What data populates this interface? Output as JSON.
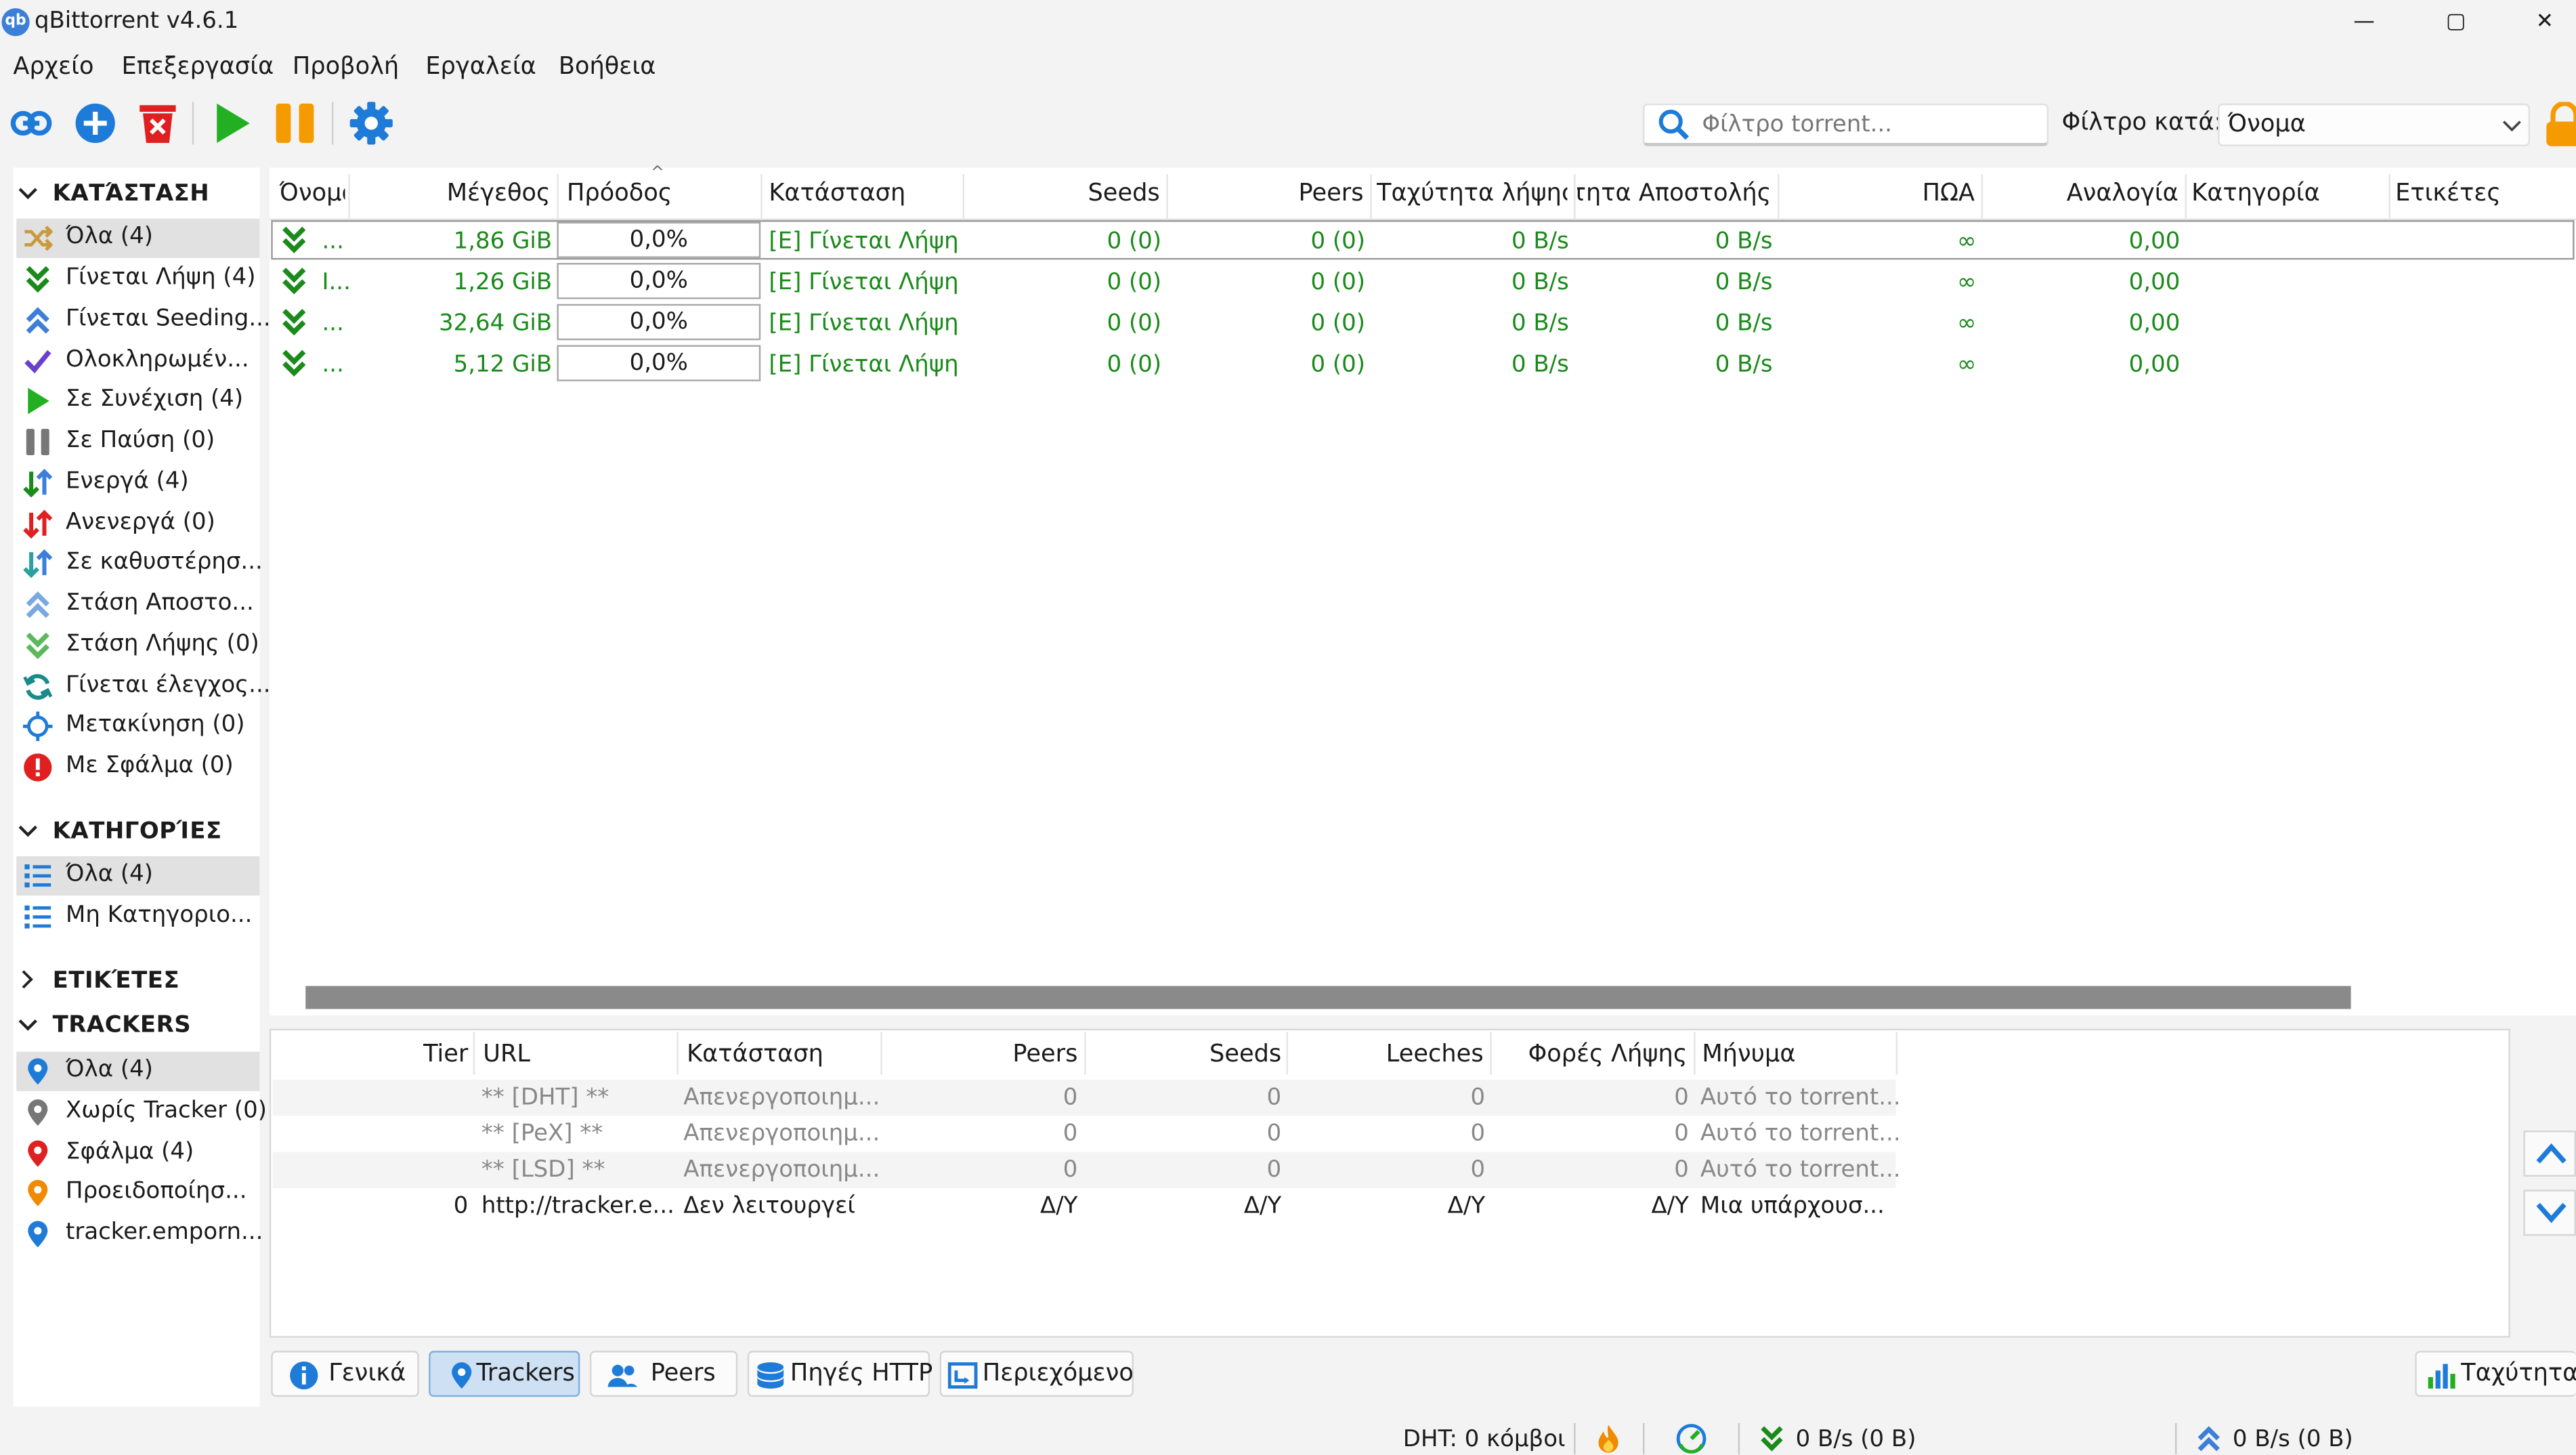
{
  "window": {
    "title": "qBittorrent v4.6.1",
    "logo": "qb",
    "controls": [
      "—",
      "▢",
      "✕"
    ]
  },
  "menu": [
    "Αρχείο",
    "Επεξεργασία",
    "Προβολή",
    "Εργαλεία",
    "Βοήθεια"
  ],
  "toolbar": {
    "search_placeholder": "Φίλτρο torrent...",
    "filter_label": "Φίλτρο κατά:",
    "filter_value": "Όνομα"
  },
  "sidebar": {
    "status_title": "ΚΑΤΆΣΤΑΣΗ",
    "status": [
      {
        "label": "Όλα (4)",
        "icon": "shuffle-icon"
      },
      {
        "label": "Γίνεται Λήψη (4)",
        "icon": "download-icon"
      },
      {
        "label": "Γίνεται Seeding...",
        "icon": "upload-icon"
      },
      {
        "label": "Ολοκληρωμέν...",
        "icon": "check-icon"
      },
      {
        "label": "Σε Συνέχιση (4)",
        "icon": "play-icon"
      },
      {
        "label": "Σε Παύση (0)",
        "icon": "pause-icon"
      },
      {
        "label": "Ενεργά (4)",
        "icon": "active-arrows-icon"
      },
      {
        "label": "Ανενεργά (0)",
        "icon": "inactive-arrows-icon"
      },
      {
        "label": "Σε καθυστέρησ...",
        "icon": "stalled-arrows-icon"
      },
      {
        "label": "Στάση Αποστο...",
        "icon": "stalled-upload-icon"
      },
      {
        "label": "Στάση Λήψης (0)",
        "icon": "stalled-download-icon"
      },
      {
        "label": "Γίνεται έλεγχος...",
        "icon": "refresh-icon"
      },
      {
        "label": "Μετακίνηση (0)",
        "icon": "move-icon"
      },
      {
        "label": "Με Σφάλμα (0)",
        "icon": "error-icon"
      }
    ],
    "categories_title": "ΚΑΤΗΓΟΡΊΕΣ",
    "categories": [
      "Όλα (4)",
      "Μη Κατηγοριο..."
    ],
    "tags_title": "ΕΤΙΚΈΤΕΣ",
    "trackers_title": "TRACKERS",
    "trackers": [
      {
        "label": "Όλα (4)",
        "color": "#1e7bd8"
      },
      {
        "label": "Χωρίς Tracker (0)",
        "color": "#777777"
      },
      {
        "label": "Σφάλμα (4)",
        "color": "#e02020"
      },
      {
        "label": "Προειδοποίησ...",
        "color": "#f08a00"
      },
      {
        "label": "tracker.emporn...",
        "color": "#1e7bd8"
      }
    ]
  },
  "torrents": {
    "sort_indicator": "^",
    "columns": [
      "Όνομα",
      "Μέγεθος",
      "Πρόοδος",
      "Κατάσταση",
      "Seeds",
      "Peers",
      "Ταχύτητα λήψης",
      "ητητα Αποστολής",
      "ΠΩΑ",
      "Αναλογία",
      "Κατηγορία",
      "Ετικέτες"
    ],
    "rows": [
      {
        "name": "...",
        "size": "1,86 GiB",
        "progress": "0,0%",
        "status": "[Ε] Γίνεται Λήψη",
        "seeds": "0 (0)",
        "peers": "0 (0)",
        "dl": "0 B/s",
        "ul": "0 B/s",
        "eta": "∞",
        "ratio": "0,00"
      },
      {
        "name": "I...",
        "size": "1,26 GiB",
        "progress": "0,0%",
        "status": "[Ε] Γίνεται Λήψη",
        "seeds": "0 (0)",
        "peers": "0 (0)",
        "dl": "0 B/s",
        "ul": "0 B/s",
        "eta": "∞",
        "ratio": "0,00"
      },
      {
        "name": "...",
        "size": "32,64 GiB",
        "progress": "0,0%",
        "status": "[Ε] Γίνεται Λήψη",
        "seeds": "0 (0)",
        "peers": "0 (0)",
        "dl": "0 B/s",
        "ul": "0 B/s",
        "eta": "∞",
        "ratio": "0,00"
      },
      {
        "name": "...",
        "size": "5,12 GiB",
        "progress": "0,0%",
        "status": "[Ε] Γίνεται Λήψη",
        "seeds": "0 (0)",
        "peers": "0 (0)",
        "dl": "0 B/s",
        "ul": "0 B/s",
        "eta": "∞",
        "ratio": "0,00"
      }
    ]
  },
  "trackers_panel": {
    "columns": [
      "Tier",
      "URL",
      "Κατάσταση",
      "Peers",
      "Seeds",
      "Leeches",
      "Φορές Λήψης",
      "Μήνυμα"
    ],
    "rows": [
      {
        "tier": "",
        "url": "** [DHT] **",
        "status": "Απενεργοποιημ...",
        "peers": "0",
        "seeds": "0",
        "leeches": "0",
        "downloaded": "0",
        "message": "Αυτό το torrent..."
      },
      {
        "tier": "",
        "url": "** [PeX] **",
        "status": "Απενεργοποιημ...",
        "peers": "0",
        "seeds": "0",
        "leeches": "0",
        "downloaded": "0",
        "message": "Αυτό το torrent..."
      },
      {
        "tier": "",
        "url": "** [LSD] **",
        "status": "Απενεργοποιημ...",
        "peers": "0",
        "seeds": "0",
        "leeches": "0",
        "downloaded": "0",
        "message": "Αυτό το torrent..."
      },
      {
        "tier": "0",
        "url": "http://tracker.e...",
        "status": "Δεν λειτουργεί",
        "peers": "Δ/Υ",
        "seeds": "Δ/Υ",
        "leeches": "Δ/Υ",
        "downloaded": "Δ/Υ",
        "message": "Μια υπάρχουσ..."
      }
    ]
  },
  "tabs": [
    "Γενικά",
    "Trackers",
    "Peers",
    "Πηγές HTTP",
    "Περιεχόμενο"
  ],
  "speed_button": "Ταχύτητα",
  "status_bar": {
    "dht": "DHT: 0 κόμβοι",
    "download": "0 B/s (0 B)",
    "upload": "0 B/s (0 B)"
  },
  "colors": {
    "green": "#1a8a1a",
    "blue": "#1e7bd8",
    "red": "#e02020",
    "orange": "#f08a00"
  }
}
